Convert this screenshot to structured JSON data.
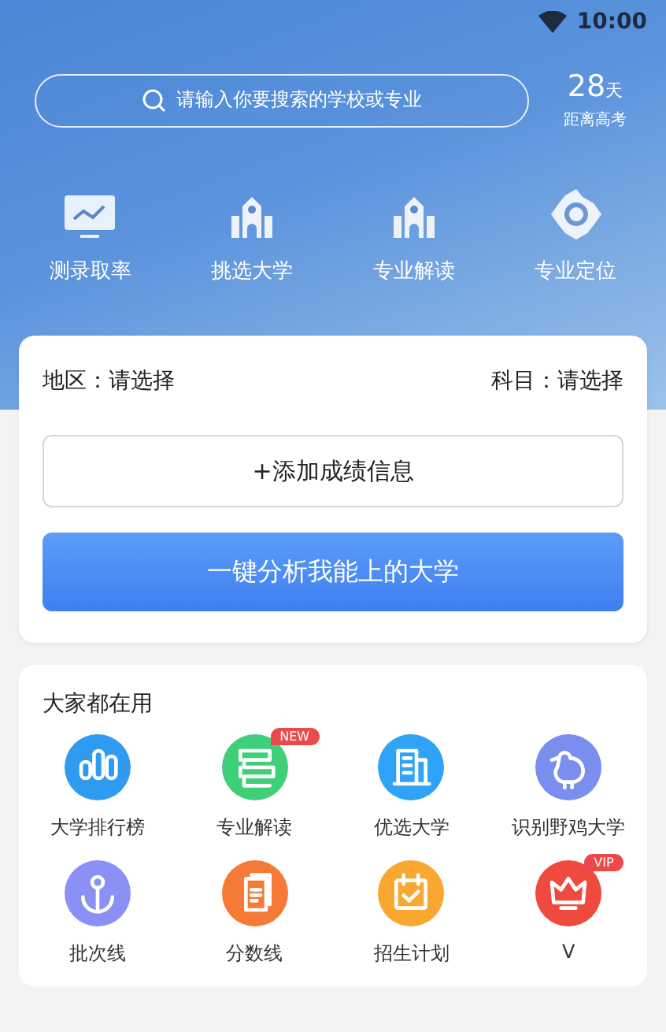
{
  "status_bar": {
    "time": "10:00"
  },
  "search": {
    "placeholder": "请输入你要搜索的学校或专业"
  },
  "countdown": {
    "number": "28",
    "unit": "天",
    "caption": "距离高考"
  },
  "quick_actions": [
    {
      "kind": "chart",
      "label": "测录取率"
    },
    {
      "kind": "campus",
      "label": "挑选大学"
    },
    {
      "kind": "campus",
      "label": "专业解读"
    },
    {
      "kind": "target",
      "label": "专业定位"
    }
  ],
  "filters": [
    {
      "label": "地区：",
      "value": "请选择"
    },
    {
      "label": "科目：",
      "value": "请选择"
    }
  ],
  "add_button": "+添加成绩信息",
  "analyze_button": "一键分析我能上的大学",
  "tools": {
    "title": "大家都在用",
    "items": [
      {
        "kind": "ranking",
        "label": "大学排行榜",
        "color": "#2f9bf0"
      },
      {
        "kind": "book",
        "label": "专业解读",
        "color": "#3fcf78",
        "badge": "NEW"
      },
      {
        "kind": "building",
        "label": "优选大学",
        "color": "#2fa3f5"
      },
      {
        "kind": "bird",
        "label": "识别野鸡大学",
        "color": "#7a8ef0"
      },
      {
        "kind": "anchor",
        "label": "批次线",
        "color": "#8a90f5"
      },
      {
        "kind": "docs",
        "label": "分数线",
        "color": "#f57a35"
      },
      {
        "kind": "calendar",
        "label": "招生计划",
        "color": "#f8a830"
      },
      {
        "kind": "crown",
        "label": "V",
        "color": "#f04a3e",
        "badge": "VIP"
      }
    ]
  }
}
